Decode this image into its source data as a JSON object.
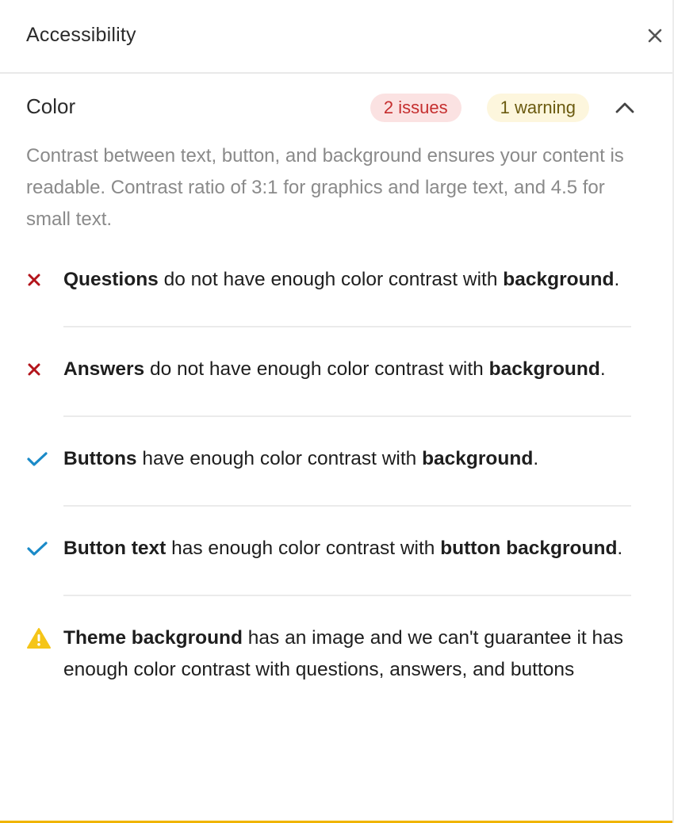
{
  "panel": {
    "title": "Accessibility",
    "close_icon": "close-icon"
  },
  "section": {
    "title": "Color",
    "issues_badge": "2 issues",
    "warning_badge": "1 warning",
    "toggle_icon": "chevron-up-icon",
    "description": "Contrast between text, button, and background ensures your content is readable. Contrast ratio of 3:1 for graphics and large text, and 4.5 for small text."
  },
  "checks": [
    {
      "status": "error",
      "icon": "error-x-icon",
      "subject": "Questions",
      "middle": " do not have enough color contrast with ",
      "target": "background",
      "end": "."
    },
    {
      "status": "error",
      "icon": "error-x-icon",
      "subject": "Answers",
      "middle": " do not have enough color contrast with ",
      "target": "background",
      "end": "."
    },
    {
      "status": "pass",
      "icon": "checkmark-icon",
      "subject": "Buttons",
      "middle": " have enough color contrast with ",
      "target": "background",
      "end": "."
    },
    {
      "status": "pass",
      "icon": "checkmark-icon",
      "subject": "Button text",
      "middle": " has enough color contrast with ",
      "target": "button background",
      "end": "."
    },
    {
      "status": "warning",
      "icon": "warning-triangle-icon",
      "subject": "Theme background",
      "middle": " has an image and we can't guarantee it has enough color contrast with questions, answers, and buttons",
      "target": "",
      "end": ""
    }
  ],
  "colors": {
    "error": "#b3141b",
    "pass": "#1a8ac8",
    "warning": "#f5c518",
    "issues_badge_bg": "#fbe2e2",
    "warning_badge_bg": "#fdf6dd"
  }
}
